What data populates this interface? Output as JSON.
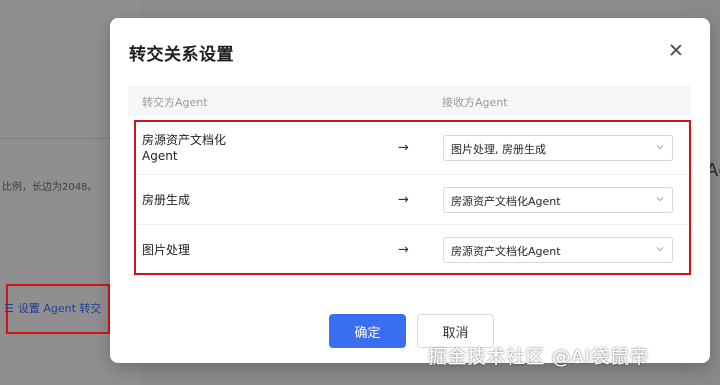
{
  "background": {
    "left_text": "比例，长边为2048。",
    "agent_link_icon": "list-indent-icon",
    "agent_link_label": "设置 Agent 转交",
    "right_glyph": "Ag"
  },
  "dialog": {
    "title": "转交关系设置",
    "close_icon": "close-icon",
    "columns": {
      "source": "转交方Agent",
      "target": "接收方Agent"
    },
    "rows": [
      {
        "source": "房源资产文档化Agent",
        "arrow": "→",
        "target": "图片处理, 房册生成"
      },
      {
        "source": "房册生成",
        "arrow": "→",
        "target": "房源资产文档化Agent"
      },
      {
        "source": "图片处理",
        "arrow": "→",
        "target": "房源资产文档化Agent"
      }
    ],
    "confirm_label": "确定",
    "cancel_label": "取消"
  },
  "watermark": "掘金技术社区 @AI袋鼠帝",
  "colors": {
    "primary": "#3a6df0",
    "highlight": "#d01515"
  }
}
